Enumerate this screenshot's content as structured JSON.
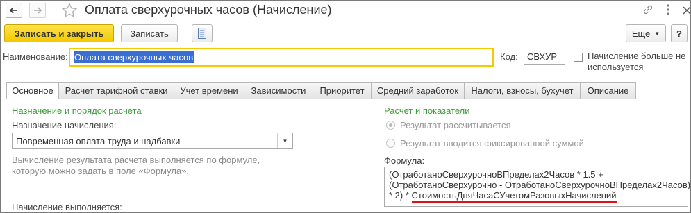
{
  "window": {
    "title": "Оплата сверхурочных часов (Начисление)"
  },
  "toolbar": {
    "save_close": "Записать и закрыть",
    "save": "Записать",
    "more": "Еще",
    "help": "?"
  },
  "header": {
    "name_label": "Наименование:",
    "name_value": "Оплата сверхурочных часов",
    "code_label": "Код:",
    "code_value": "СВХУР",
    "unused_line1": "Начисление больше не",
    "unused_line2": "используется"
  },
  "tabs": [
    {
      "label": "Основное"
    },
    {
      "label": "Расчет тарифной ставки"
    },
    {
      "label": "Учет времени"
    },
    {
      "label": "Зависимости"
    },
    {
      "label": "Приоритет"
    },
    {
      "label": "Средний заработок"
    },
    {
      "label": "Налоги, взносы, бухучет"
    },
    {
      "label": "Описание"
    }
  ],
  "left": {
    "section_title": "Назначение и порядок расчета",
    "purpose_label": "Назначение начисления:",
    "purpose_value": "Повременная оплата труда и надбавки",
    "hint_line1": "Вычисление результата расчета выполняется по формуле,",
    "hint_line2": "которую можно задать в поле «Формула».",
    "executes_label": "Начисление выполняется:"
  },
  "right": {
    "section_title": "Расчет и показатели",
    "radio_computed": "Результат рассчитывается",
    "radio_fixed": "Результат вводится фиксированной суммой",
    "formula_label": "Формула:",
    "formula_line1": "(ОтработаноСверхурочноВПределах2Часов * 1.5 +",
    "formula_line2": "(ОтработаноСверхурочно - ОтработаноСверхурочноВПределах2Часов)",
    "formula_line3_prefix": "* 2) * ",
    "formula_line3_highlight": "СтоимостьДняЧасаСУчетомРазовыхНачислений"
  },
  "colors": {
    "accent_yellow": "#f5c900",
    "section_green": "#3b9c3b",
    "underline_red": "#e0101c",
    "selection_blue": "#3a6fd1"
  }
}
